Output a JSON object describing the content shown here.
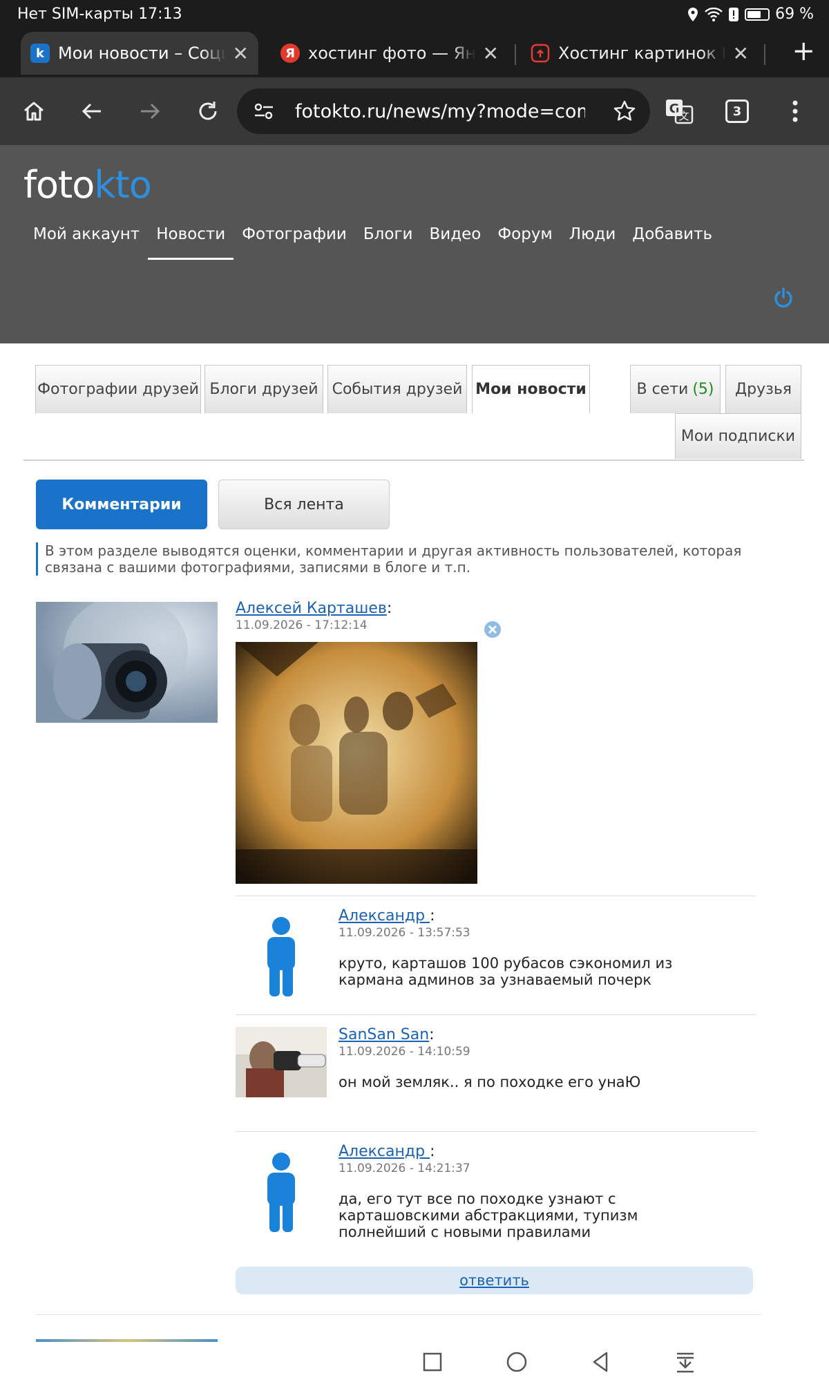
{
  "status": {
    "left": "Нет SIM-карты 17:13",
    "battery": "69 %",
    "battery_level": 0.69
  },
  "tabs": [
    {
      "title": "Мои новости – Социальная",
      "favicon_letter": "k",
      "favicon_color": "#1a73c9"
    },
    {
      "title": "хостинг фото — Яндекс",
      "favicon_letter": "Я",
      "favicon_color": "#e3382c"
    },
    {
      "title": "Хостинг картинок Ilmage",
      "favicon_letter": "",
      "favicon_color": "#e53935"
    }
  ],
  "toolbar": {
    "url": "fotokto.ru/news/my?mode=comments",
    "tab_count": "3",
    "icons": [
      "home-icon",
      "back-icon",
      "forward-icon",
      "reload-icon",
      "site-settings-icon",
      "star-icon",
      "translate-icon",
      "tabs-icon",
      "menu-icon"
    ]
  },
  "site": {
    "logo_foto": "foto",
    "logo_kto": "kto",
    "brand_color": "#2e8fde",
    "nav": [
      "Мой аккаунт",
      "Новости",
      "Фотографии",
      "Блоги",
      "Видео",
      "Форум",
      "Люди",
      "Добавить"
    ],
    "nav_active": "Новости"
  },
  "subtabs": {
    "friends_photos": "Фотографии друзей",
    "friends_blogs": "Блоги друзей",
    "friends_events": "События друзей",
    "my_news": "Мои новости",
    "online": "В сети",
    "online_count": "(5)",
    "friends": "Друзья",
    "subscriptions": "Мои подписки"
  },
  "filters": {
    "comments": "Комментарии",
    "all_feed": "Вся лента"
  },
  "info_text": "В этом разделе выводятся оценки, комментарии и другая активность пользователей, которая связана с вашими фотографиями, записями в блоге и т.п.",
  "post": {
    "author": "Алексей Карташев",
    "colon": ":",
    "date": "11.09.2026 - 17:12:14"
  },
  "comments": [
    {
      "author": "Александр ",
      "date": "11.09.2026 - 13:57:53",
      "text": "круто, карташов 100 рубасов сэкономил из кармана админов за узнаваемый почерк"
    },
    {
      "author": "SanSan San",
      "date": "11.09.2026 - 14:10:59",
      "text": "он мой земляк.. я по походке его унаЮ"
    },
    {
      "author": "Александр ",
      "date": "11.09.2026 - 14:21:37",
      "text": "да, его тут все по походке узнают с карташовскими абстракциями, тупизм полнейший с новыми правилами"
    }
  ],
  "reply_label": "ответить"
}
